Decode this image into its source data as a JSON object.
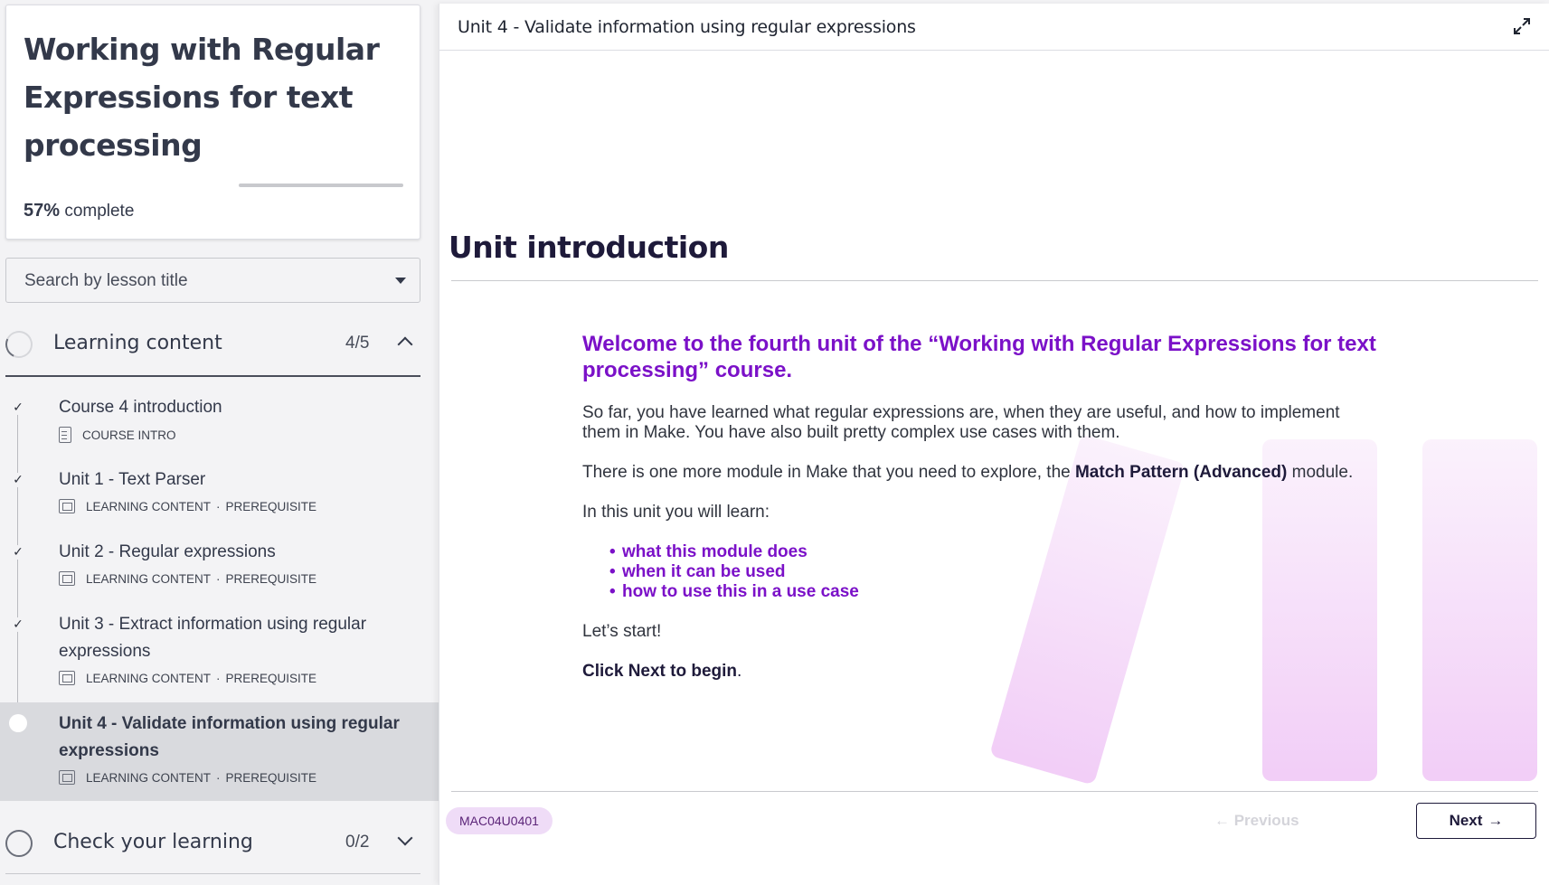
{
  "course": {
    "title": "Working with Regular Expressions for text processing",
    "progress_percent": "57%",
    "progress_suffix": "complete"
  },
  "search": {
    "placeholder": "Search by lesson title"
  },
  "sections": [
    {
      "label": "Learning content",
      "count": "4/5",
      "expanded": true
    },
    {
      "label": "Check your learning",
      "count": "0/2",
      "expanded": false
    }
  ],
  "lessons": [
    {
      "title": "Course 4 introduction",
      "type": "COURSE INTRO",
      "tag": "",
      "completed": true
    },
    {
      "title": "Unit 1 - Text Parser",
      "type": "LEARNING CONTENT",
      "tag": "PREREQUISITE",
      "completed": true
    },
    {
      "title": "Unit 2 - Regular expressions",
      "type": "LEARNING CONTENT",
      "tag": "PREREQUISITE",
      "completed": true
    },
    {
      "title": "Unit 3 - Extract information using regular expressions",
      "type": "LEARNING CONTENT",
      "tag": "PREREQUISITE",
      "completed": true
    },
    {
      "title": "Unit 4 - Validate information using regular expressions",
      "type": "LEARNING CONTENT",
      "tag": "PREREQUISITE",
      "completed": false,
      "active": true
    }
  ],
  "meta_separator": "·",
  "main": {
    "header_title": "Unit 4 - Validate information using regular expressions",
    "heading": "Unit introduction",
    "welcome": "Welcome to the fourth unit of the “Working with Regular Expressions for text processing” course.",
    "para1": "So far, you have learned what regular expressions are, when they are useful, and how to implement them in Make. You have also built pretty complex use cases with them.",
    "para2_start": "There is one more module in Make that you need to explore, the ",
    "para2_bold": "Match Pattern (Advanced)",
    "para2_end": " module.",
    "para3": "In this unit you will learn:",
    "bullets": [
      "what this module does",
      "when it can be used",
      "how to use this in a use case"
    ],
    "para4": "Let’s start!",
    "cta": "Click Next to begin",
    "cta_end": ".",
    "code": "MAC04U0401",
    "prev_label": "← Previous",
    "next_label": "Next",
    "next_arrow": "→"
  },
  "colors": {
    "accent": "#7b11c8",
    "dark": "#1e1a3a",
    "badge_bg": "#efdcf7"
  },
  "icons": {
    "expand": "expand-icon",
    "check": "check-icon",
    "chevron_up": "chevron-up-icon",
    "chevron_down": "chevron-down-icon"
  }
}
